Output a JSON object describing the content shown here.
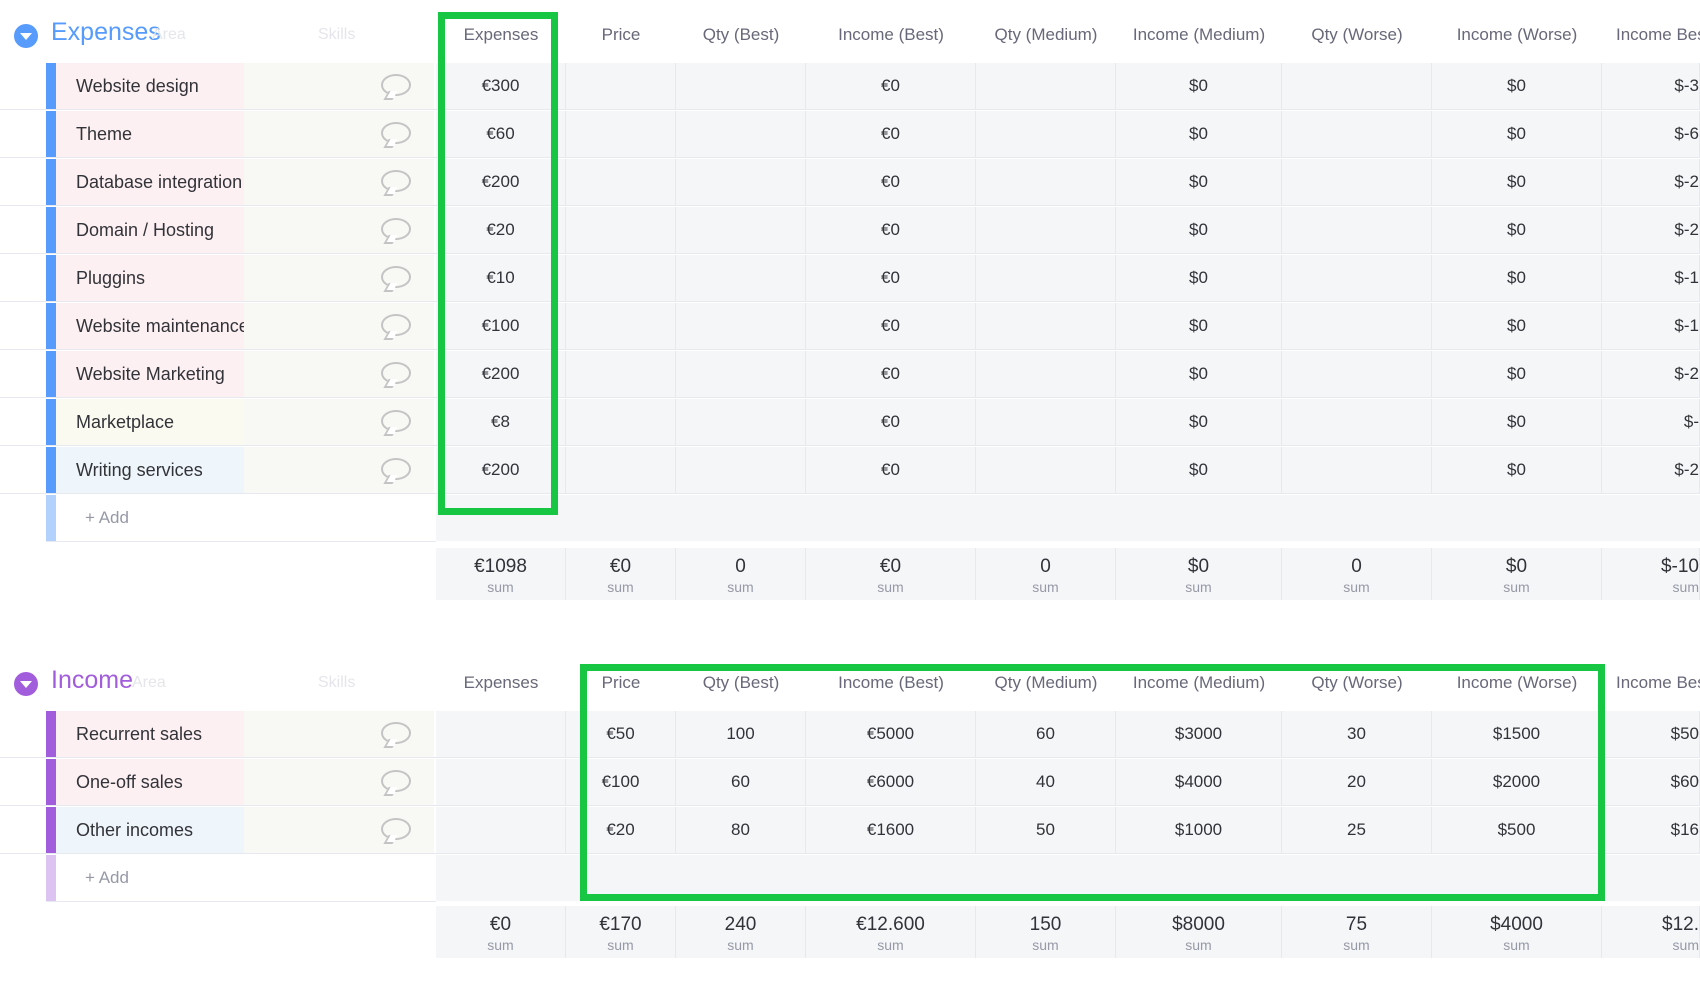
{
  "columns": [
    "Expenses",
    "Price",
    "Qty (Best)",
    "Income (Best)",
    "Qty (Medium)",
    "Income (Medium)",
    "Qty (Worse)",
    "Income (Worse)",
    "Income Bes"
  ],
  "colors": {
    "expenses_group": "#579bfc",
    "income_group": "#a25ddc",
    "highlight": "#17c743"
  },
  "icons": {
    "collapse": "chevron-down-icon",
    "updates": "speech-bubble-icon"
  },
  "expenses": {
    "title": "Expenses",
    "ghost_area": "Area",
    "ghost_skills": "Skills",
    "add_label": "+ Add",
    "rows": [
      {
        "name": "Website design",
        "values": [
          "€300",
          "",
          "",
          "€0",
          "",
          "$0",
          "",
          "$0",
          "$-3"
        ]
      },
      {
        "name": "Theme",
        "values": [
          "€60",
          "",
          "",
          "€0",
          "",
          "$0",
          "",
          "$0",
          "$-6"
        ]
      },
      {
        "name": "Database integration",
        "values": [
          "€200",
          "",
          "",
          "€0",
          "",
          "$0",
          "",
          "$0",
          "$-2"
        ]
      },
      {
        "name": "Domain / Hosting",
        "values": [
          "€20",
          "",
          "",
          "€0",
          "",
          "$0",
          "",
          "$0",
          "$-2"
        ]
      },
      {
        "name": "Pluggins",
        "values": [
          "€10",
          "",
          "",
          "€0",
          "",
          "$0",
          "",
          "$0",
          "$-1"
        ]
      },
      {
        "name": "Website maintenance",
        "values": [
          "€100",
          "",
          "",
          "€0",
          "",
          "$0",
          "",
          "$0",
          "$-1"
        ]
      },
      {
        "name": "Website Marketing",
        "values": [
          "€200",
          "",
          "",
          "€0",
          "",
          "$0",
          "",
          "$0",
          "$-2"
        ]
      },
      {
        "name": "Marketplace",
        "values": [
          "€8",
          "",
          "",
          "€0",
          "",
          "$0",
          "",
          "$0",
          "$-"
        ]
      },
      {
        "name": "Writing services",
        "values": [
          "€200",
          "",
          "",
          "€0",
          "",
          "$0",
          "",
          "$0",
          "$-2"
        ]
      }
    ],
    "sums": [
      "€1098",
      "€0",
      "0",
      "€0",
      "0",
      "$0",
      "0",
      "$0",
      "$-10"
    ],
    "sum_label": "sum"
  },
  "income": {
    "title": "Income",
    "ghost_area": "Area",
    "ghost_skills": "Skills",
    "add_label": "+ Add",
    "rows": [
      {
        "name": "Recurrent sales",
        "values": [
          "",
          "€50",
          "100",
          "€5000",
          "60",
          "$3000",
          "30",
          "$1500",
          "$50"
        ]
      },
      {
        "name": "One-off sales",
        "values": [
          "",
          "€100",
          "60",
          "€6000",
          "40",
          "$4000",
          "20",
          "$2000",
          "$60"
        ]
      },
      {
        "name": "Other incomes",
        "values": [
          "",
          "€20",
          "80",
          "€1600",
          "50",
          "$1000",
          "25",
          "$500",
          "$16"
        ]
      }
    ],
    "sums": [
      "€0",
      "€170",
      "240",
      "€12.600",
      "150",
      "$8000",
      "75",
      "$4000",
      "$12."
    ],
    "sum_label": "sum"
  }
}
